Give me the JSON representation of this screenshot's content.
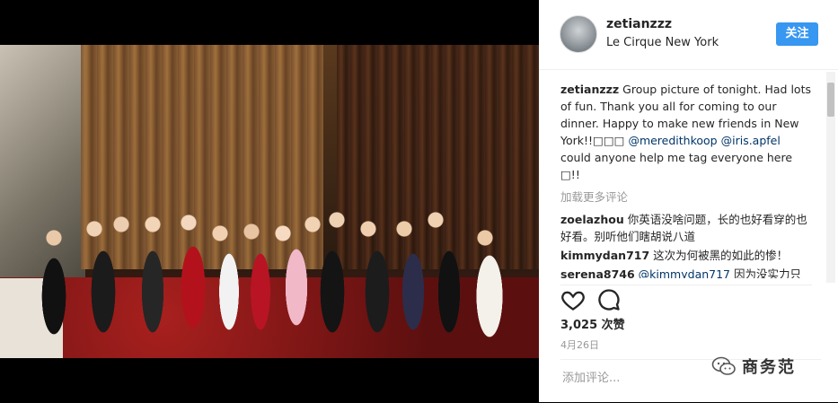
{
  "post": {
    "username": "zetianzzz",
    "location": "Le Cirque New York",
    "follow_label": "关注"
  },
  "caption": {
    "username": "zetianzzz",
    "text_1": " Group picture of tonight. Had lots of fun. Thank you all for coming to our dinner. Happy to make new friends in New York!!□□□ ",
    "mention_1": "@meredithkoop",
    "mention_2": "@iris.apfel",
    "text_2": " could anyone help me tag everyone here □!!"
  },
  "load_more_label": "加载更多评论",
  "comments": [
    {
      "user": "zoelazhou",
      "text": " 你英语没啥问题，长的也好看穿的也好看。别听他们瞎胡说八道"
    },
    {
      "user": "kimmydan717",
      "text": " 这次为何被黑的如此的惨！"
    },
    {
      "user": "serena8746",
      "mention": "@kimmydan717",
      "text": " 因为没实力只"
    }
  ],
  "likes": "3,025 次赞",
  "date": "4月26日",
  "add_comment_placeholder": "添加评论...",
  "watermark_text": "商务范",
  "colors": {
    "follow_bg": "#3897f0",
    "mention": "#003569",
    "muted": "#999999"
  },
  "icons": {
    "like": "heart-outline-icon",
    "comment": "speech-bubble-icon",
    "watermark": "wechat-logo-icon"
  }
}
